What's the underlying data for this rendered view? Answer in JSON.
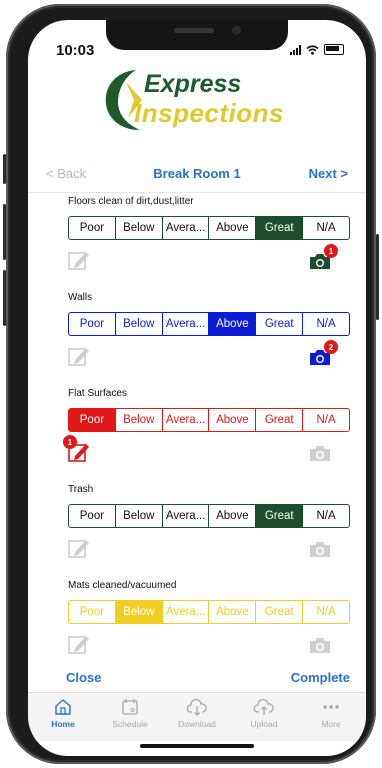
{
  "status_bar": {
    "time": "10:03"
  },
  "logo": {
    "line1": "Express",
    "line2": "Inspections"
  },
  "nav": {
    "back_label": "< Back",
    "title": "Break Room 1",
    "next_label": "Next >"
  },
  "rating_options": [
    "Poor",
    "Below",
    "Avera...",
    "Above",
    "Great",
    "N/A"
  ],
  "questions": [
    {
      "label": "Floors clean of dirt,dust,litter",
      "selected": "Great",
      "accent": "#1b4d2e",
      "note_badge": "",
      "photo_badge": "1",
      "camera_color": "#1b4d2e"
    },
    {
      "label": "Walls",
      "selected": "Above",
      "accent": "#0b1bd8",
      "note_badge": "",
      "photo_badge": "2",
      "camera_color": "#0b1bd8"
    },
    {
      "label": "Flat Surfaces",
      "selected": "Poor",
      "accent": "#e01818",
      "note_badge": "1",
      "photo_badge": "",
      "camera_color": "#cfcfcf"
    },
    {
      "label": "Trash",
      "selected": "Great",
      "accent": "#1b4d2e",
      "note_badge": "",
      "photo_badge": "",
      "camera_color": "#cfcfcf"
    },
    {
      "label": "Mats cleaned/vacuumed",
      "selected": "Below",
      "accent": "#f0cf22",
      "note_badge": "",
      "photo_badge": "",
      "camera_color": "#cfcfcf"
    }
  ],
  "actions": {
    "close_label": "Close",
    "complete_label": "Complete"
  },
  "tabs": [
    {
      "label": "Home",
      "icon": "home-icon",
      "active": true
    },
    {
      "label": "Schedule",
      "icon": "calendar-icon",
      "active": false
    },
    {
      "label": "Download",
      "icon": "cloud-download-icon",
      "active": false
    },
    {
      "label": "Upload",
      "icon": "cloud-upload-icon",
      "active": false
    },
    {
      "label": "More",
      "icon": "more-icon",
      "active": false
    }
  ],
  "colors": {
    "link_blue": "#2a6fd2",
    "disabled_gray": "#cfcfcf",
    "badge_red": "#e01818"
  }
}
